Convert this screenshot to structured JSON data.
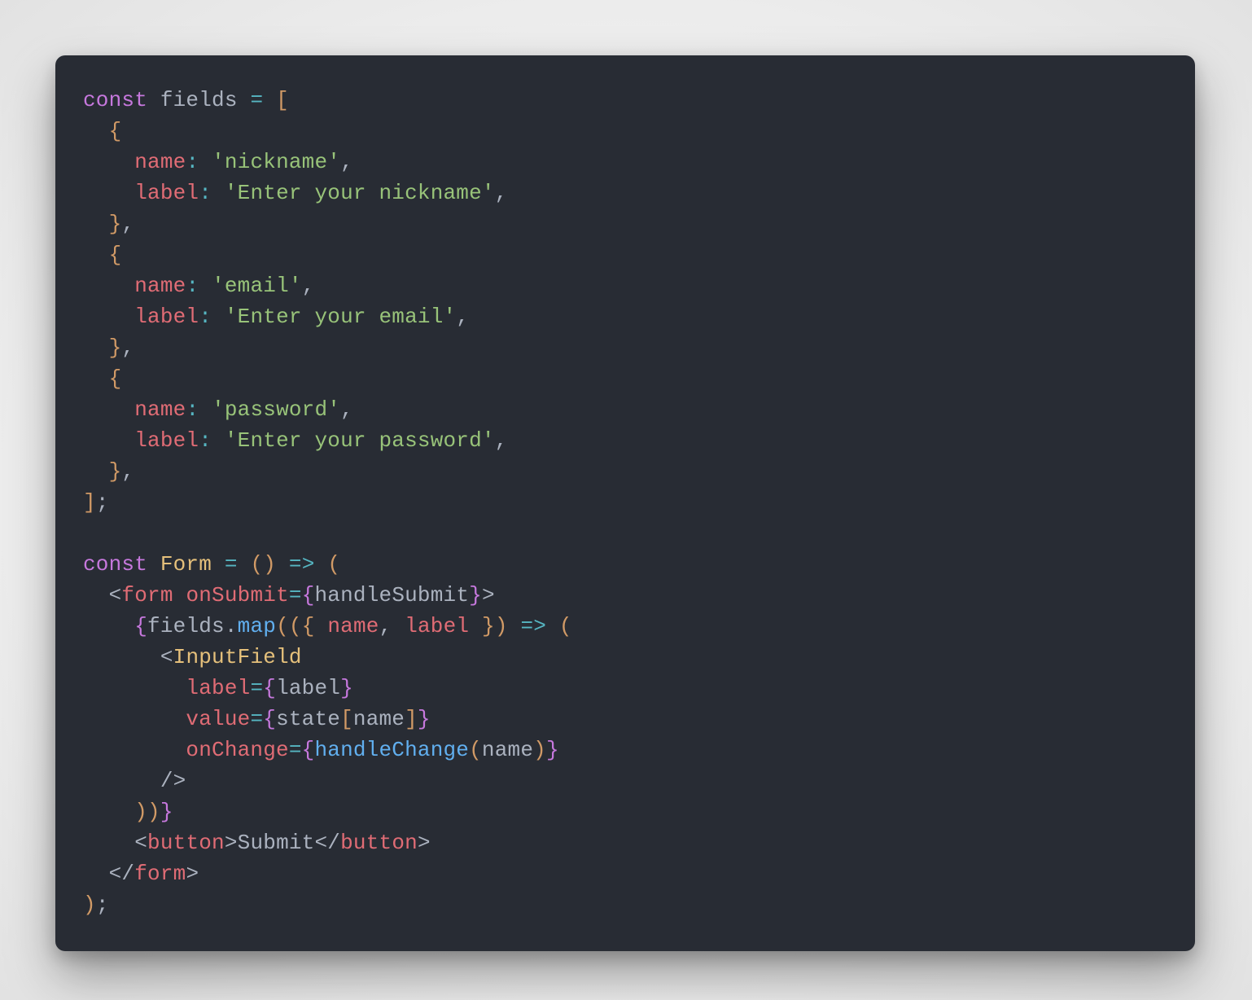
{
  "code": {
    "kw_const_1": "const",
    "var_fields": "fields",
    "op_eq": "=",
    "br_open_sq": "[",
    "br_open_cu": "{",
    "attr_name": "name",
    "op_colon": ":",
    "str_nickname": "'nickname'",
    "punct_comma": ",",
    "attr_label": "label",
    "str_enter_nickname": "'Enter your nickname'",
    "br_close_cu": "}",
    "str_email": "'email'",
    "str_enter_email": "'Enter your email'",
    "str_password": "'password'",
    "str_enter_password": "'Enter your password'",
    "br_close_sq": "]",
    "kw_const_2": "const",
    "var_Form": "Form",
    "par_open": "(",
    "par_close": ")",
    "op_arrow": "=>",
    "angle_open": "<",
    "tag_form": "form",
    "attr_onSubmit": "onSubmit",
    "jsx_br_open": "{",
    "ident_handleSubmit": "handleSubmit",
    "jsx_br_close": "}",
    "angle_close": ">",
    "ident_fields": "fields",
    "dot": ".",
    "fn_map": "map",
    "ident_name": "name",
    "ident_label": "label",
    "comp_InputField": "InputField",
    "attr_label_jsx": "label",
    "attr_value": "value",
    "ident_state": "state",
    "sq_open": "[",
    "sq_close": "]",
    "attr_onChange": "onChange",
    "fn_handleChange": "handleChange",
    "self_close": "/>",
    "tag_button": "button",
    "txt_Submit": "Submit",
    "angle_close_slash": "</",
    "semi": ";"
  }
}
